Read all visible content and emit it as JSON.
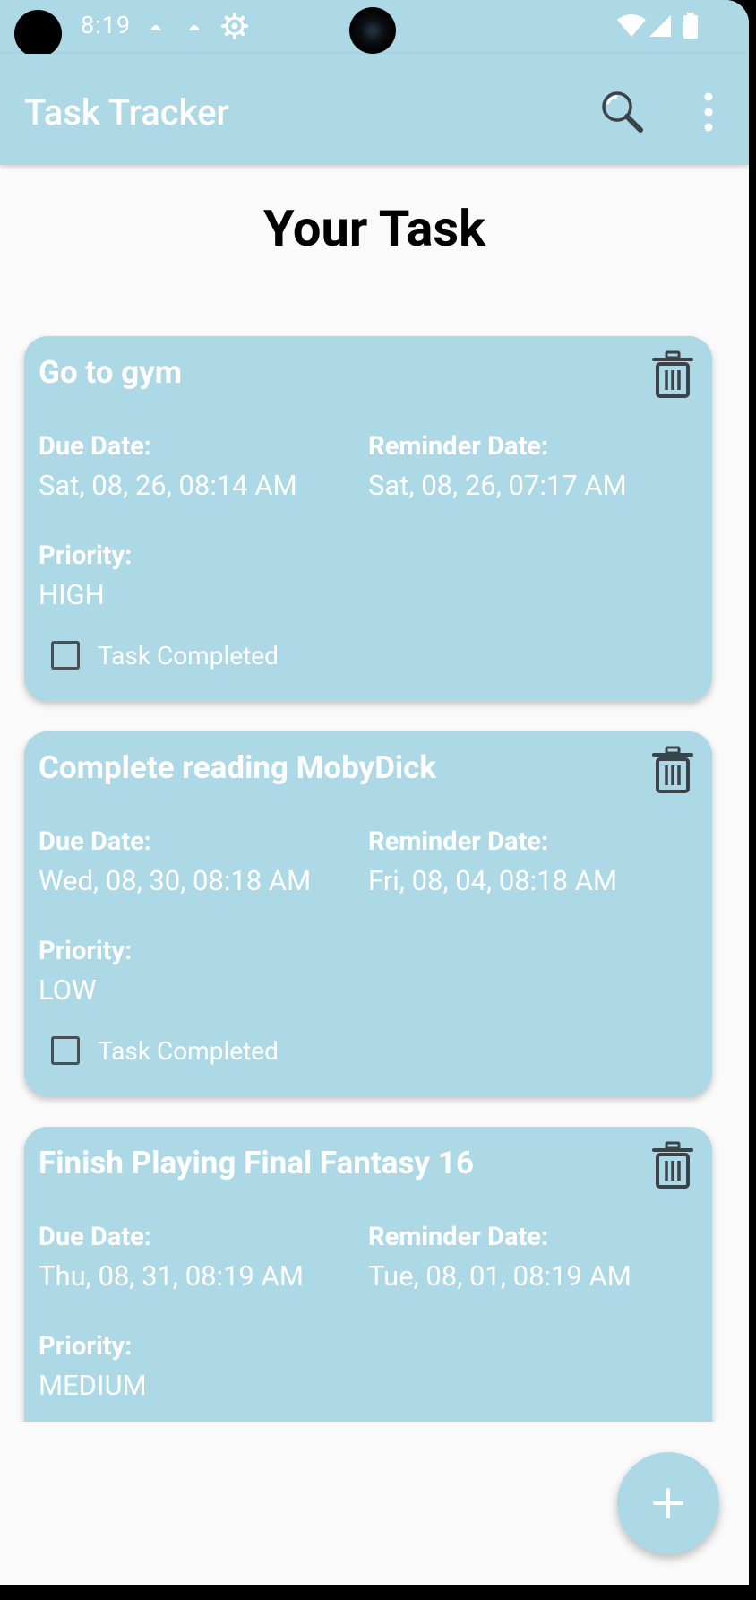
{
  "status_bar": {
    "time": "8:19",
    "icons": [
      "notification-dot-icon",
      "notification-dot-icon",
      "settings-gear-icon",
      "wifi-icon",
      "signal-icon",
      "battery-icon"
    ]
  },
  "app_bar": {
    "title": "Task Tracker",
    "actions": [
      "search-icon",
      "more-vert-icon"
    ]
  },
  "page": {
    "heading": "Your Task"
  },
  "labels": {
    "due_date": "Due Date:",
    "reminder_date": "Reminder Date:",
    "priority": "Priority:",
    "task_completed": "Task Completed"
  },
  "tasks": [
    {
      "title": "Go to gym",
      "due_date": "Sat, 08, 26, 08:14 AM",
      "reminder_date": "Sat, 08, 26, 07:17 AM",
      "priority": "HIGH",
      "completed": false
    },
    {
      "title": "Complete reading MobyDick",
      "due_date": "Wed, 08, 30, 08:18 AM",
      "reminder_date": "Fri, 08, 04, 08:18 AM",
      "priority": "LOW",
      "completed": false
    },
    {
      "title": "Finish Playing Final Fantasy 16",
      "due_date": "Thu, 08, 31, 08:19 AM",
      "reminder_date": "Tue, 08, 01, 08:19 AM",
      "priority": "MEDIUM",
      "completed": false
    }
  ],
  "fab": {
    "icon": "add-icon"
  },
  "colors": {
    "primary": "#add8e6",
    "background": "#fafafa",
    "text_on_primary": "#ffffff",
    "icon_dark": "#3c4248"
  }
}
